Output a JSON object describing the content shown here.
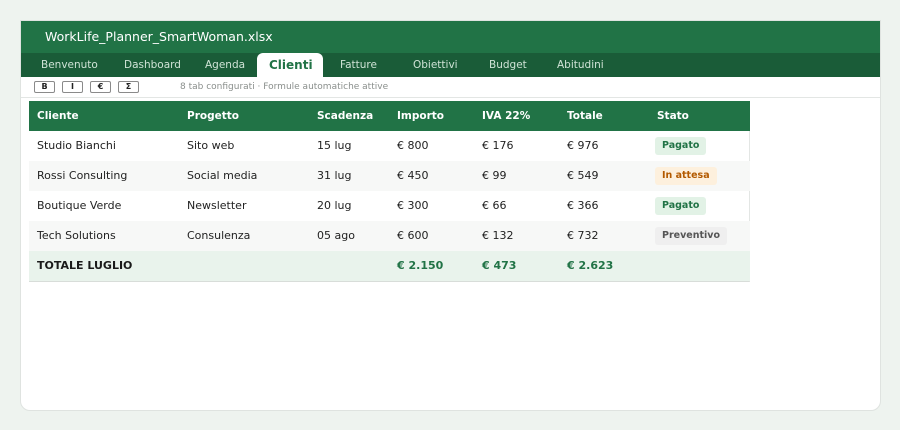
{
  "window": {
    "title": "WorkLife_Planner_SmartWoman.xlsx"
  },
  "tabs": [
    {
      "label": "Benvenuto"
    },
    {
      "label": "Dashboard"
    },
    {
      "label": "Agenda"
    },
    {
      "label": "Clienti"
    },
    {
      "label": "Fatture"
    },
    {
      "label": "Obiettivi"
    },
    {
      "label": "Budget"
    },
    {
      "label": "Abitudini"
    }
  ],
  "active_tab": "Clienti",
  "toolbar": {
    "buttons": [
      "B",
      "I",
      "€",
      "Σ"
    ],
    "info": "8 tab configurati  ·  Formule automatiche attive"
  },
  "table": {
    "headers": [
      "Cliente",
      "Progetto",
      "Scadenza",
      "Importo",
      "IVA 22%",
      "Totale",
      "Stato"
    ],
    "rows": [
      {
        "cliente": "Studio Bianchi",
        "progetto": "Sito web",
        "scadenza": "15 lug",
        "importo": "€ 800",
        "iva": "€ 176",
        "totale": "€ 976",
        "stato": "Pagato"
      },
      {
        "cliente": "Rossi Consulting",
        "progetto": "Social media",
        "scadenza": "31 lug",
        "importo": "€ 450",
        "iva": "€ 99",
        "totale": "€ 549",
        "stato": "In attesa"
      },
      {
        "cliente": "Boutique Verde",
        "progetto": "Newsletter",
        "scadenza": "20 lug",
        "importo": "€ 300",
        "iva": "€ 66",
        "totale": "€ 366",
        "stato": "Pagato"
      },
      {
        "cliente": "Tech Solutions",
        "progetto": "Consulenza",
        "scadenza": "05 ago",
        "importo": "€ 600",
        "iva": "€ 132",
        "totale": "€ 732",
        "stato": "Preventivo"
      }
    ],
    "total": {
      "label": "TOTALE LUGLIO",
      "importo": "€ 2.150",
      "iva": "€ 473",
      "totale": "€ 2.623"
    }
  },
  "colors": {
    "brand_green": "#217346",
    "tab_bar": "#1a5c38",
    "status_paid": "#217346",
    "status_pending": "#b35a00",
    "status_quote": "#555555"
  }
}
